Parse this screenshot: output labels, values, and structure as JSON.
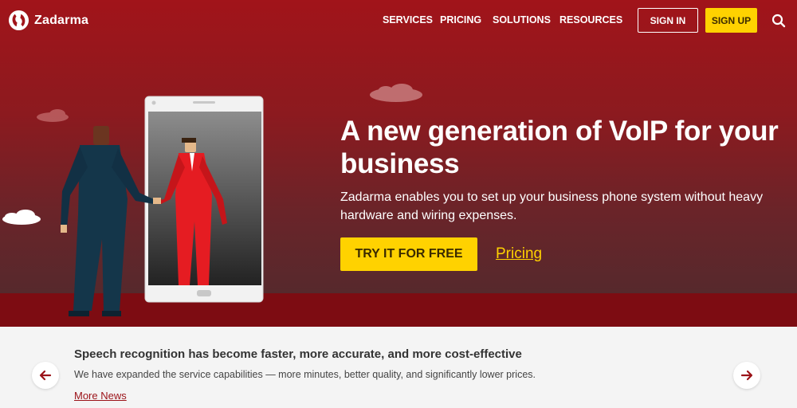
{
  "brand": {
    "name": "Zadarma"
  },
  "nav": {
    "links": [
      "SERVICES",
      "PRICING",
      "SOLUTIONS",
      "RESOURCES"
    ],
    "sign_in": "SIGN IN",
    "sign_up": "SIGN UP"
  },
  "hero": {
    "title": "A new generation of VoIP for your business",
    "subtitle": "Zadarma enables you to set up your business phone system without heavy hardware and wiring expenses.",
    "cta": "TRY IT FOR FREE",
    "pricing_link": "Pricing"
  },
  "news": {
    "title": "Speech recognition has become faster, more accurate, and more cost-effective",
    "text": "We have expanded the service capabilities — more minutes, better quality, and significantly lower prices.",
    "more": "More News"
  },
  "colors": {
    "accent_yellow": "#ffd200",
    "brand_red": "#9b1218"
  },
  "icons": [
    "zadarma-logo-icon",
    "search-icon",
    "arrow-left-icon",
    "arrow-right-icon"
  ]
}
